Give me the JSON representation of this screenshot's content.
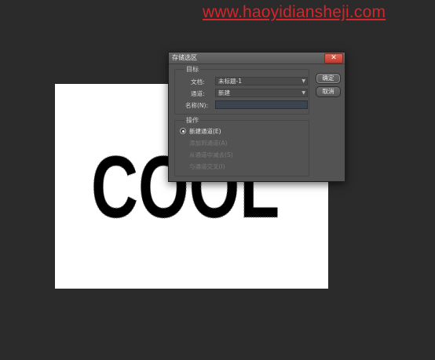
{
  "watermark": "www.haoyidiansheji.com",
  "document": {
    "art_text": "COOL"
  },
  "dialog": {
    "title": "存储选区",
    "close_label": "✕",
    "target_group_label": "目标",
    "document_label": "文档:",
    "document_value": "未标题-1",
    "channel_label": "通道:",
    "channel_value": "新建",
    "name_label": "名称(N):",
    "name_value": "",
    "operation_group_label": "操作",
    "operations": [
      {
        "label": "新建通道(E)",
        "selected": true,
        "enabled": true
      },
      {
        "label": "添加到通道(A)",
        "selected": false,
        "enabled": false
      },
      {
        "label": "从通道中减去(S)",
        "selected": false,
        "enabled": false
      },
      {
        "label": "与通道交叉(I)",
        "selected": false,
        "enabled": false
      }
    ],
    "ok_label": "确定",
    "cancel_label": "取消"
  }
}
